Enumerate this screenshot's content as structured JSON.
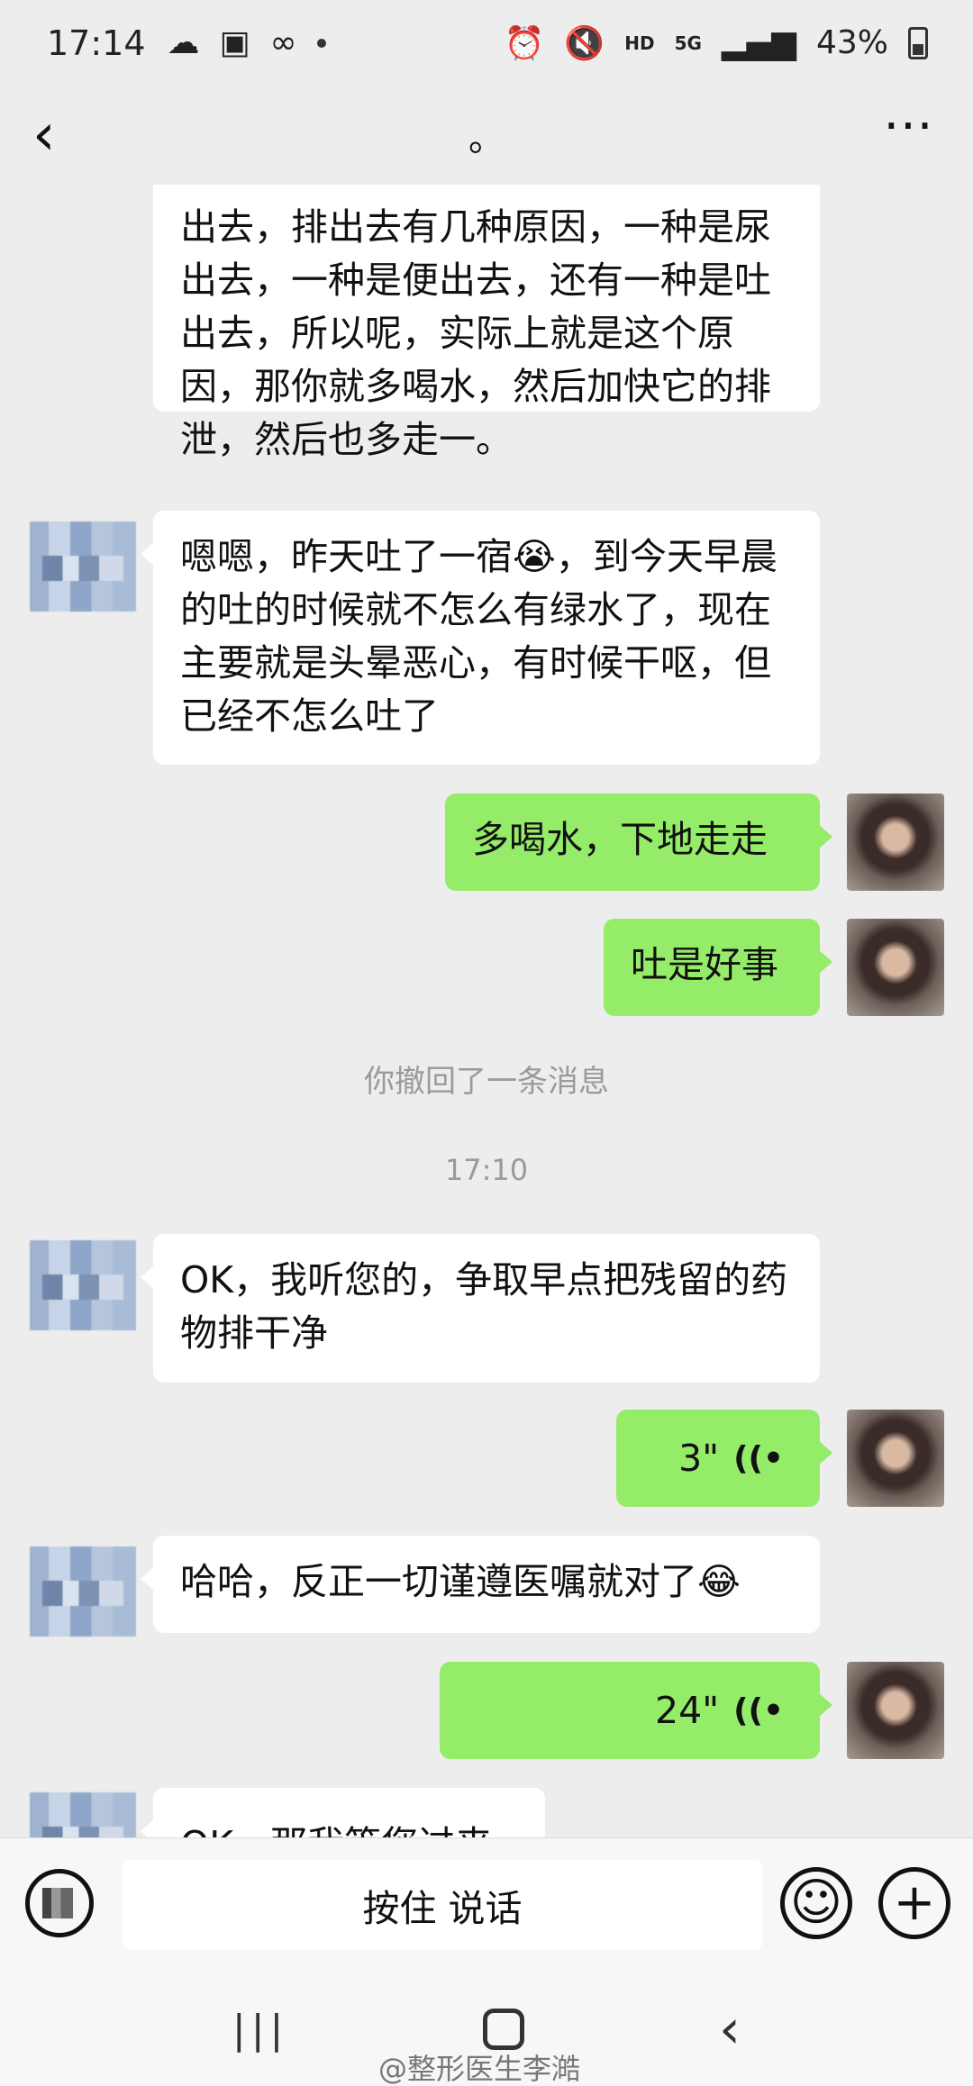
{
  "status_bar": {
    "time": "17:14",
    "net_hd": "HD",
    "net_5g": "5G",
    "battery": "43%"
  },
  "nav": {
    "back_icon": "‹",
    "title": "。",
    "more_icon": "⋯"
  },
  "messages": [
    {
      "side": "left",
      "text": "出去，排出去有几种原因，一种是尿出去，一种是便出去，还有一种是吐出去，所以呢，实际上就是这个原因，那你就多喝水，然后加快它的排泄，然后也多走一。"
    },
    {
      "side": "left",
      "text": "嗯嗯，昨天吐了一宿😭，到今天早晨的吐的时候就不怎么有绿水了，现在主要就是头晕恶心，有时候干呕，但已经不怎么吐了"
    },
    {
      "side": "right",
      "text": "多喝水，下地走走"
    },
    {
      "side": "right",
      "text": "吐是好事"
    },
    {
      "side": "left",
      "text": "OK，我听您的，争取早点把残留的药物排干净"
    },
    {
      "side": "right",
      "text": "3\""
    },
    {
      "side": "left",
      "text": "哈哈，反正一切谨遵医嘱就对了😂"
    },
    {
      "side": "right",
      "text": "24\""
    },
    {
      "side": "left",
      "text": "OK，那我等您过来"
    }
  ],
  "recall_note": "你撤回了一条消息",
  "timestamp": "17:10",
  "input_bar": {
    "talk_label": "按住 说话",
    "emoji_icon": "☺",
    "plus_icon": "+"
  },
  "watermark": "@整形医生李澔"
}
